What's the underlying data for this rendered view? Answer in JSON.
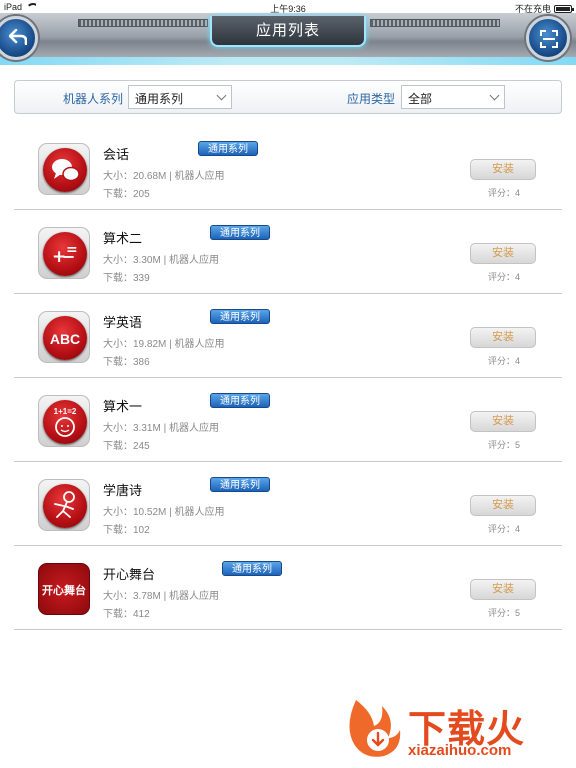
{
  "status_bar": {
    "device": "iPad",
    "time": "上午9:36",
    "charging": "不在充电"
  },
  "header": {
    "title": "应用列表",
    "back_icon": "back-arrow-icon",
    "scan_icon": "scan-icon",
    "accent": "#7adfff"
  },
  "filters": {
    "series_label": "机器人系列",
    "series_value": "通用系列",
    "type_label": "应用类型",
    "type_value": "全部"
  },
  "apps": [
    {
      "name": "会话",
      "tag": "通用系列",
      "size": "大小：20.68M | 机器人应用",
      "downloads": "下载：205",
      "install": "安装",
      "rating": "评分：4",
      "icon": "chat-bubbles-icon"
    },
    {
      "name": "算术二",
      "tag": "通用系列",
      "size": "大小：3.30M | 机器人应用",
      "downloads": "下载：339",
      "install": "安装",
      "rating": "评分：4",
      "icon": "math-symbols-icon"
    },
    {
      "name": "学英语",
      "tag": "通用系列",
      "size": "大小：19.82M | 机器人应用",
      "downloads": "下载：386",
      "install": "安装",
      "rating": "评分：4",
      "icon": "abc-icon"
    },
    {
      "name": "算术一",
      "tag": "通用系列",
      "size": "大小：3.31M | 机器人应用",
      "downloads": "下载：245",
      "install": "安装",
      "rating": "评分：5",
      "icon": "child-addition-icon",
      "icon_text": "1+1=2"
    },
    {
      "name": "学唐诗",
      "tag": "通用系列",
      "size": "大小：10.52M | 机器人应用",
      "downloads": "下载：102",
      "install": "安装",
      "rating": "评分：4",
      "icon": "reading-child-icon"
    },
    {
      "name": "开心舞台",
      "tag": "通用系列",
      "size": "大小：3.78M | 机器人应用",
      "downloads": "下载：412",
      "install": "安装",
      "rating": "评分：5",
      "icon": "happy-stage-icon",
      "icon_text": "开心舞台"
    }
  ],
  "watermark": {
    "title": "下载火",
    "url": "xiazaihuo.com",
    "icon": "flame-logo-icon"
  },
  "colors": {
    "tag_blue": "#1d63b8",
    "install_text": "#d69a4e",
    "label_blue": "#2c67a3"
  }
}
